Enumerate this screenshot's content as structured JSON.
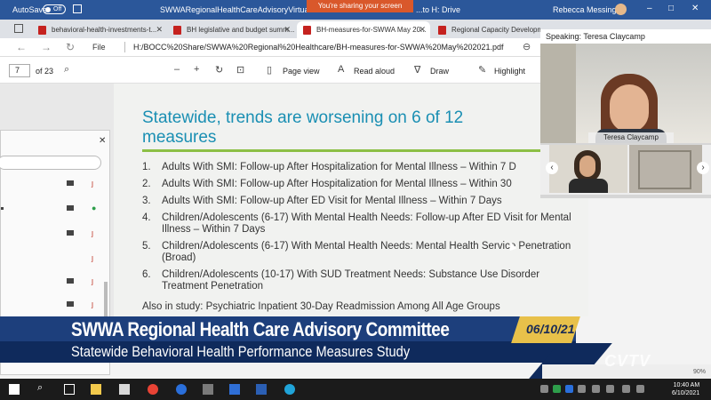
{
  "titlebar": {
    "autosave": "AutoSave",
    "toggle": "Off",
    "doc_title": "SWWARegionalHealthCareAdvisoryVirtual...",
    "sharing": "You're sharing your screen",
    "drive": "...to H: Drive",
    "user": "Rebecca Messinger"
  },
  "tabs": [
    {
      "label": "behavioral-health-investments-t..."
    },
    {
      "label": "BH legislative and budget summ..."
    },
    {
      "label": "BH-measures-for-SWWA May 20..."
    },
    {
      "label": "Regional Capacity Developme..."
    }
  ],
  "address": {
    "file": "File",
    "url": "H:/BOCC%20Share/SWWA%20Regional%20Healthcare/BH-measures-for-SWWA%20May%202021.pdf"
  },
  "pdf_toolbar": {
    "page": "7",
    "of": "of 23",
    "page_view": "Page view",
    "read_aloud": "Read aloud",
    "draw": "Draw",
    "highlight": "Highlight"
  },
  "slide": {
    "title": "Statewide, trends are worsening on 6 of 12 measures",
    "items": [
      {
        "n": "1.",
        "text": "Adults With SMI: Follow-up After Hospitalization for Mental Illness – Within 7 D"
      },
      {
        "n": "2.",
        "text": "Adults With SMI: Follow-up After Hospitalization for Mental Illness – Within 30"
      },
      {
        "n": "3.",
        "text": "Adults With SMI: Follow-up After ED Visit for Mental Illness – Within 7 Days"
      },
      {
        "n": "4.",
        "text": "Children/Adolescents (6-17) With Mental Health Needs: Follow-up After ED Visit for Mental Illness – Within 7 Days"
      },
      {
        "n": "5.",
        "text": "Children/Adolescents (6-17) With Mental Health Needs: Mental Health Service Penetration (Broad)"
      },
      {
        "n": "6.",
        "text": "Children/Adolescents (10-17) With SUD Treatment Needs: Substance Use Disorder Treatment Penetration"
      }
    ],
    "also": "Also in study: Psychiatric Inpatient 30-Day Readmission Among All Age Groups"
  },
  "video": {
    "speaking": "Speaking: Teresa Claycamp",
    "name_tag": "Teresa Claycamp"
  },
  "banner": {
    "title": "SWWA Regional Health Care Advisory Committee",
    "subtitle": "Statewide Behavioral Health Performance Measures Study",
    "date": "06/10/21"
  },
  "watermark": "CVTV",
  "status": {
    "zoom": "90%"
  },
  "clock": {
    "time": "10:40 AM",
    "date": "6/10/2021"
  }
}
